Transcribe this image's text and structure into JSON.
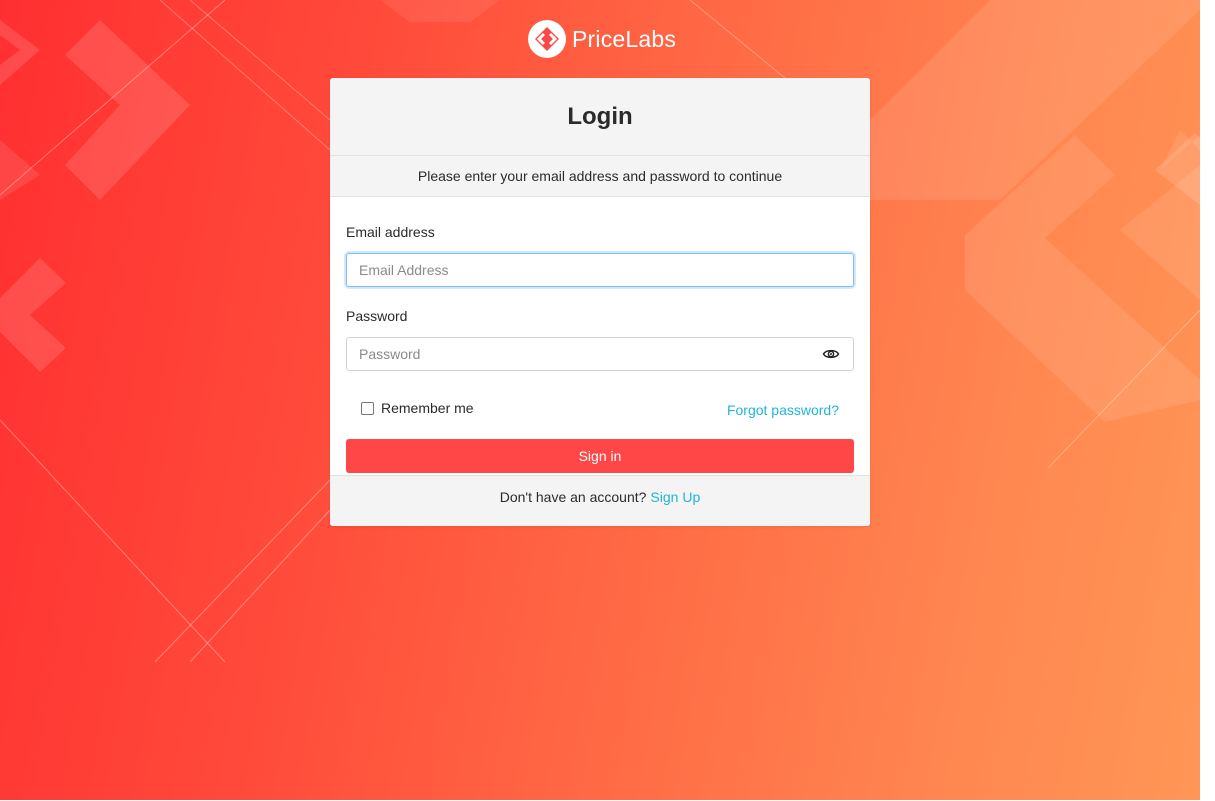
{
  "brand": {
    "name": "PriceLabs",
    "logo_icon": "chevrons-logo-icon",
    "logo_color": "#ff4747"
  },
  "login": {
    "title": "Login",
    "subtitle": "Please enter your email address and password to continue",
    "email_label": "Email address",
    "email_placeholder": "Email Address",
    "email_value": "",
    "password_label": "Password",
    "password_placeholder": "Password",
    "password_value": "",
    "password_toggle_icon": "eye-icon",
    "remember_label": "Remember me",
    "remember_checked": false,
    "forgot_label": "Forgot password?",
    "signin_label": "Sign in",
    "footer_text": "Don't have an account?",
    "signup_label": "Sign Up"
  },
  "colors": {
    "accent": "#ff4747",
    "link": "#1fb6d8",
    "gradient_start": "#ff2f31",
    "gradient_end": "#ff9656"
  }
}
